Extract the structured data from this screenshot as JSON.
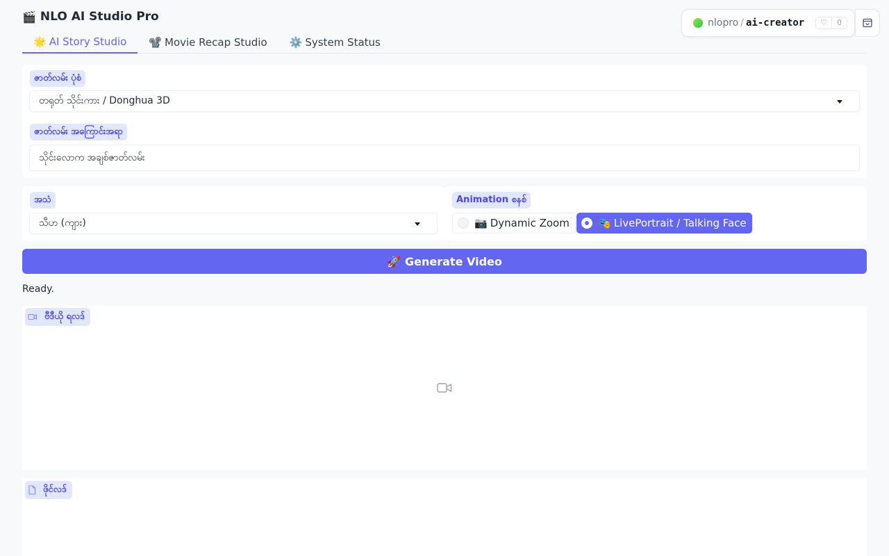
{
  "app": {
    "title": "NLO AI Studio Pro",
    "title_icon": "🎬"
  },
  "hf": {
    "owner": "nlopro",
    "separator": "/",
    "repo": "ai-creator",
    "likes": "0"
  },
  "tabs": [
    {
      "icon": "🌟",
      "label": "AI Story Studio",
      "active": true
    },
    {
      "icon": "📽️",
      "label": "Movie Recap Studio",
      "active": false
    },
    {
      "icon": "⚙️",
      "label": "System Status",
      "active": false
    }
  ],
  "form": {
    "style_label": "ဇာတ်လမ်း ပုံစံ",
    "style_value": "တရုတ် သိုင်းကား / Donghua 3D",
    "story_label": "ဇာတ်လမ်း အကြောင်းအရာ",
    "story_value": "သိုင်းလောက အချစ်ဇာတ်လမ်း",
    "voice_label": "အသံ",
    "voice_value": "သီဟ (ကျား)",
    "animation_label": "Animation စနစ်",
    "animation_options": [
      {
        "icon": "📷",
        "label": "Dynamic Zoom",
        "selected": false
      },
      {
        "icon": "🎭",
        "label": "LivePortrait / Talking Face",
        "selected": true
      }
    ]
  },
  "generate": {
    "icon": "🚀",
    "label": "Generate Video"
  },
  "status": "Ready.",
  "outputs": {
    "video_label": "ဗီဒီယို ရလဒ်",
    "file_label": "ဖိုင်လဒ်"
  },
  "colors": {
    "accent": "#6366f1",
    "chip_bg": "#e0e7ff",
    "chip_text": "#4f46e5"
  }
}
